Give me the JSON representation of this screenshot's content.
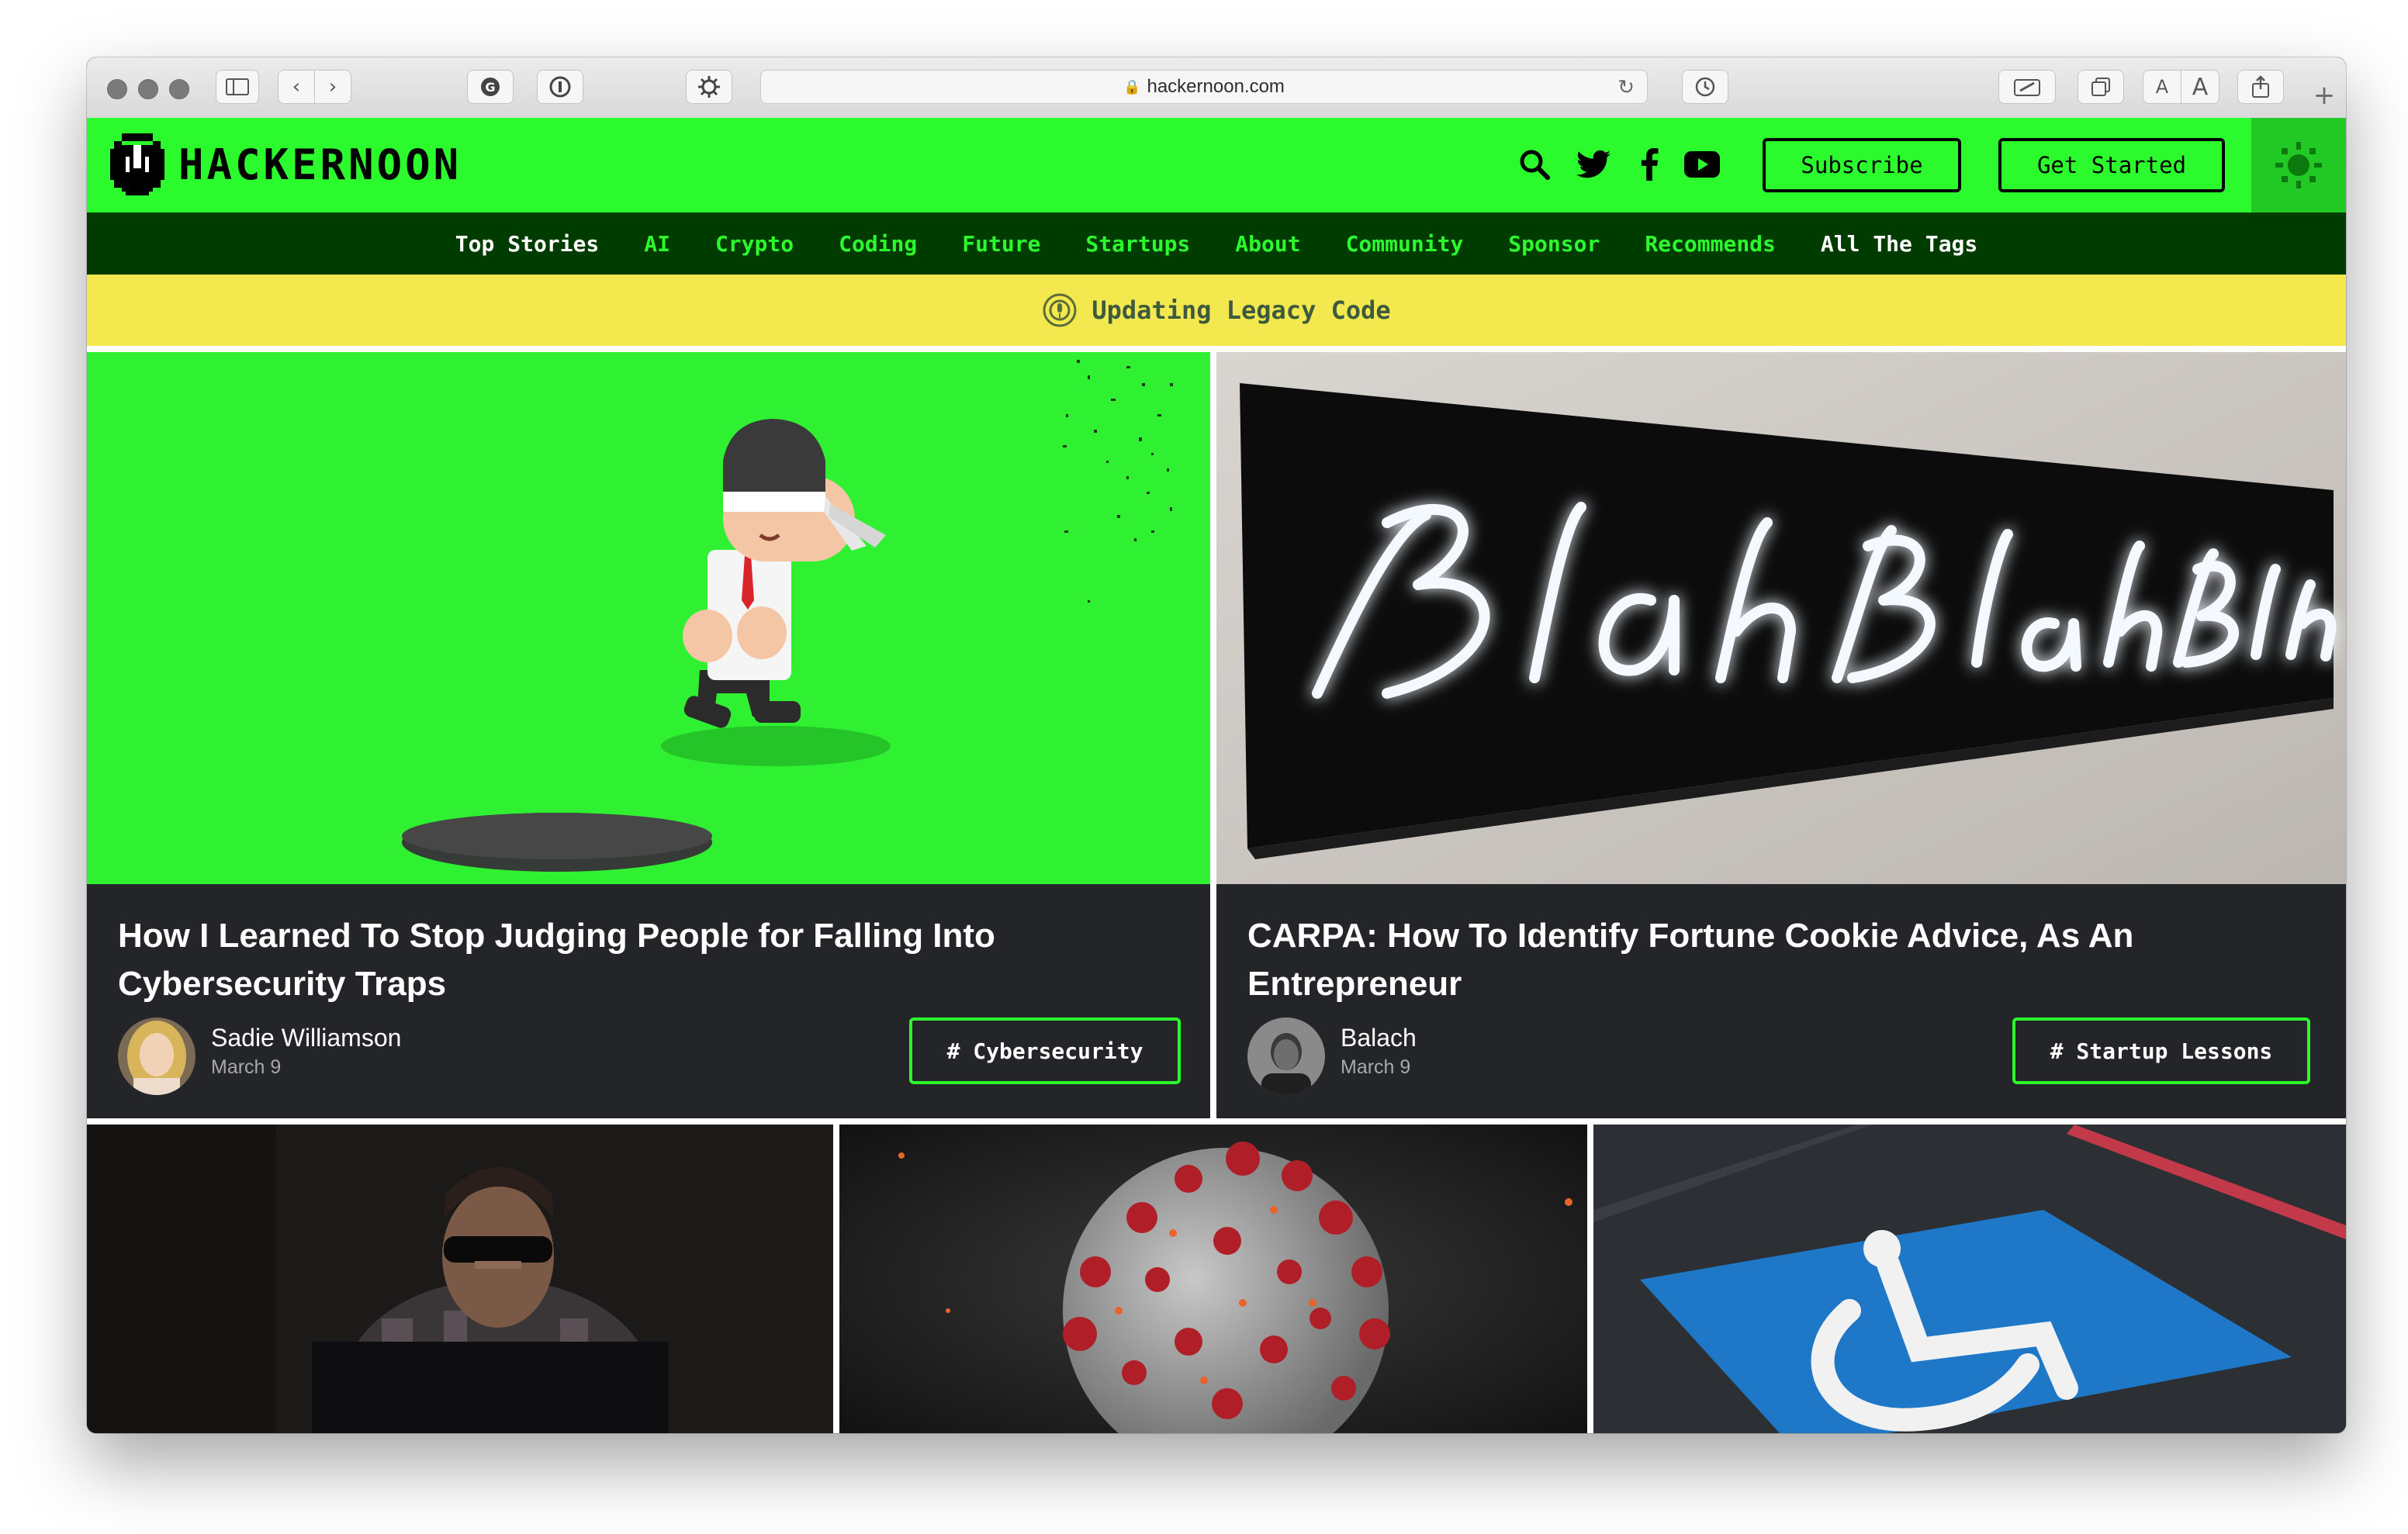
{
  "browser": {
    "url": "hackernoon.com",
    "text_size_small": "A",
    "text_size_large": "A"
  },
  "site": {
    "logo_text": "HACKERNOON",
    "subscribe_label": "Subscribe",
    "get_started_label": "Get Started",
    "accent_color": "#2bfb2d",
    "nav_bg_color": "#003b00"
  },
  "nav": {
    "items": [
      {
        "label": "Top Stories"
      },
      {
        "label": "AI"
      },
      {
        "label": "Crypto"
      },
      {
        "label": "Coding"
      },
      {
        "label": "Future"
      },
      {
        "label": "Startups"
      },
      {
        "label": "About"
      },
      {
        "label": "Community"
      },
      {
        "label": "Sponsor"
      },
      {
        "label": "Recommends"
      },
      {
        "label": "All The Tags"
      }
    ]
  },
  "banner": {
    "text": "Updating Legacy Code",
    "color": "#f3e94f"
  },
  "featured": [
    {
      "title": "How I Learned To Stop Judging People for Falling Into Cybersecurity Traps",
      "author": "Sadie Williamson",
      "date": "March 9",
      "tag": "# Cybersecurity"
    },
    {
      "title": "CARPA: How To Identify Fortune Cookie Advice, As An Entrepreneur",
      "author": "Balach",
      "date": "March 9",
      "tag": "# Startup Lessons"
    }
  ]
}
